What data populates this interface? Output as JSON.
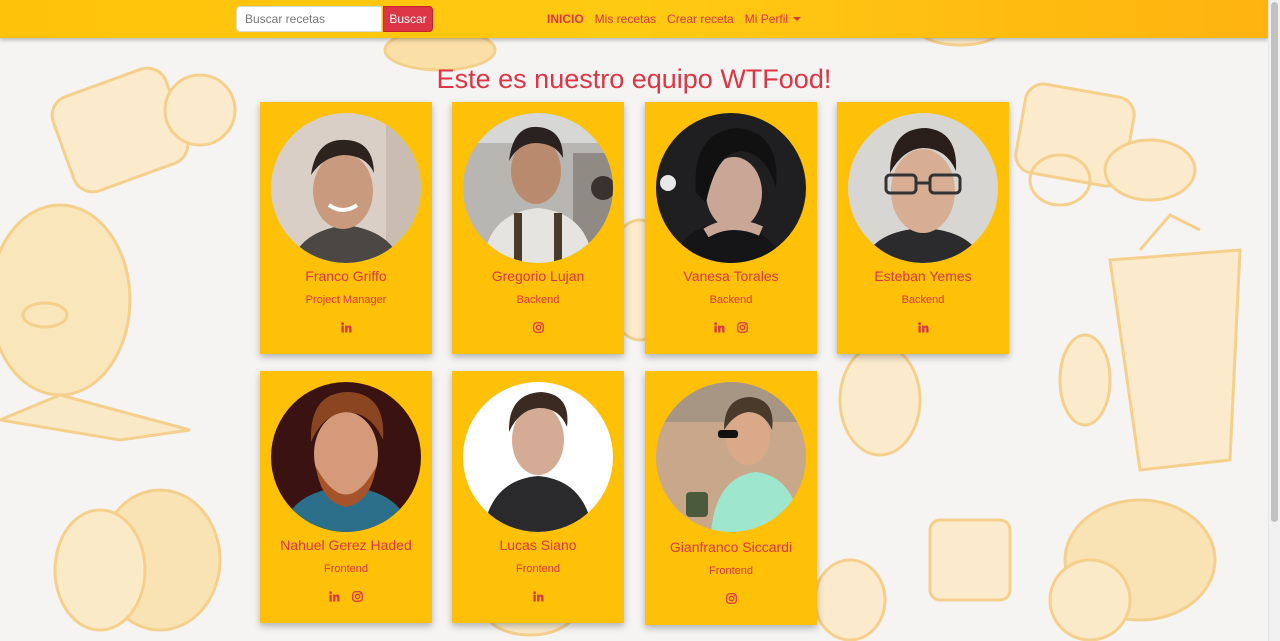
{
  "search": {
    "placeholder": "Buscar recetas",
    "button_label": "Buscar"
  },
  "nav": {
    "items": [
      {
        "label": "INICIO",
        "active": true
      },
      {
        "label": "Mis recetas"
      },
      {
        "label": "Crear receta"
      },
      {
        "label": "Mi Perfil",
        "dropdown": true
      }
    ]
  },
  "page": {
    "title": "Este es nuestro equipo WTFood!"
  },
  "colors": {
    "accent": "#dc3545",
    "card": "#ffc107",
    "navbar": "#ffc20a",
    "background": "#f5f4f3"
  },
  "team": [
    {
      "name": "Franco Griffo",
      "role": "Project Manager",
      "socials": [
        "linkedin-icon"
      ]
    },
    {
      "name": "Gregorio Lujan",
      "role": "Backend",
      "socials": [
        "instagram-icon"
      ]
    },
    {
      "name": "Vanesa Torales",
      "role": "Backend",
      "socials": [
        "linkedin-icon",
        "instagram-icon"
      ]
    },
    {
      "name": "Esteban Yemes",
      "role": "Backend",
      "socials": [
        "linkedin-icon"
      ]
    },
    {
      "name": "Nahuel Gerez Haded",
      "role": "Frontend",
      "socials": [
        "linkedin-icon",
        "instagram-icon"
      ]
    },
    {
      "name": "Lucas Siano",
      "role": "Frontend",
      "socials": [
        "linkedin-icon"
      ]
    },
    {
      "name": "Gianfranco Siccardi",
      "role": "Frontend",
      "socials": [
        "instagram-icon"
      ]
    }
  ]
}
